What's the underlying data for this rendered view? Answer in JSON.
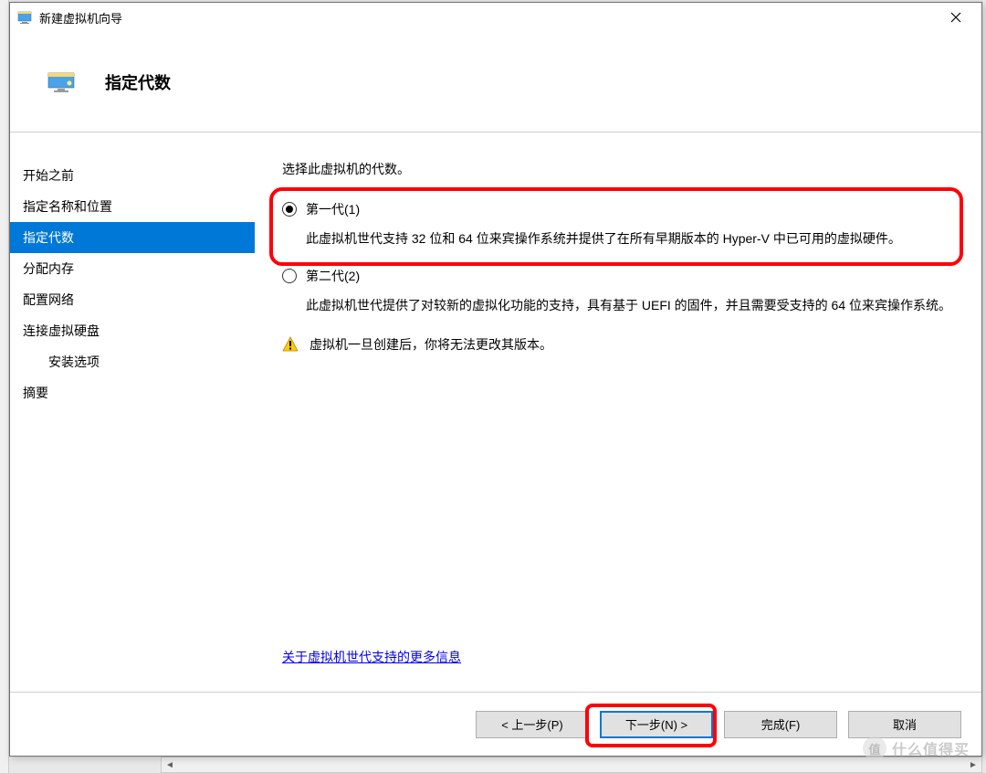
{
  "window": {
    "title": "新建虚拟机向导"
  },
  "header": {
    "title": "指定代数"
  },
  "sidebar": {
    "items": [
      {
        "label": "开始之前",
        "active": false,
        "indent": false
      },
      {
        "label": "指定名称和位置",
        "active": false,
        "indent": false
      },
      {
        "label": "指定代数",
        "active": true,
        "indent": false
      },
      {
        "label": "分配内存",
        "active": false,
        "indent": false
      },
      {
        "label": "配置网络",
        "active": false,
        "indent": false
      },
      {
        "label": "连接虚拟硬盘",
        "active": false,
        "indent": false
      },
      {
        "label": "安装选项",
        "active": false,
        "indent": true
      },
      {
        "label": "摘要",
        "active": false,
        "indent": false
      }
    ]
  },
  "content": {
    "intro": "选择此虚拟机的代数。",
    "option1": {
      "label": "第一代(1)",
      "desc": "此虚拟机世代支持 32 位和 64 位来宾操作系统并提供了在所有早期版本的 Hyper-V 中已可用的虚拟硬件。",
      "checked": true
    },
    "option2": {
      "label": "第二代(2)",
      "desc": "此虚拟机世代提供了对较新的虚拟化功能的支持，具有基于 UEFI 的固件，并且需要受支持的 64 位来宾操作系统。",
      "checked": false
    },
    "warning": "虚拟机一旦创建后，你将无法更改其版本。",
    "more_info_link": "关于虚拟机世代支持的更多信息"
  },
  "footer": {
    "prev": "< 上一步(P)",
    "next": "下一步(N) >",
    "finish": "完成(F)",
    "cancel": "取消"
  },
  "watermark": {
    "badge": "值",
    "text": "什么值得买"
  }
}
